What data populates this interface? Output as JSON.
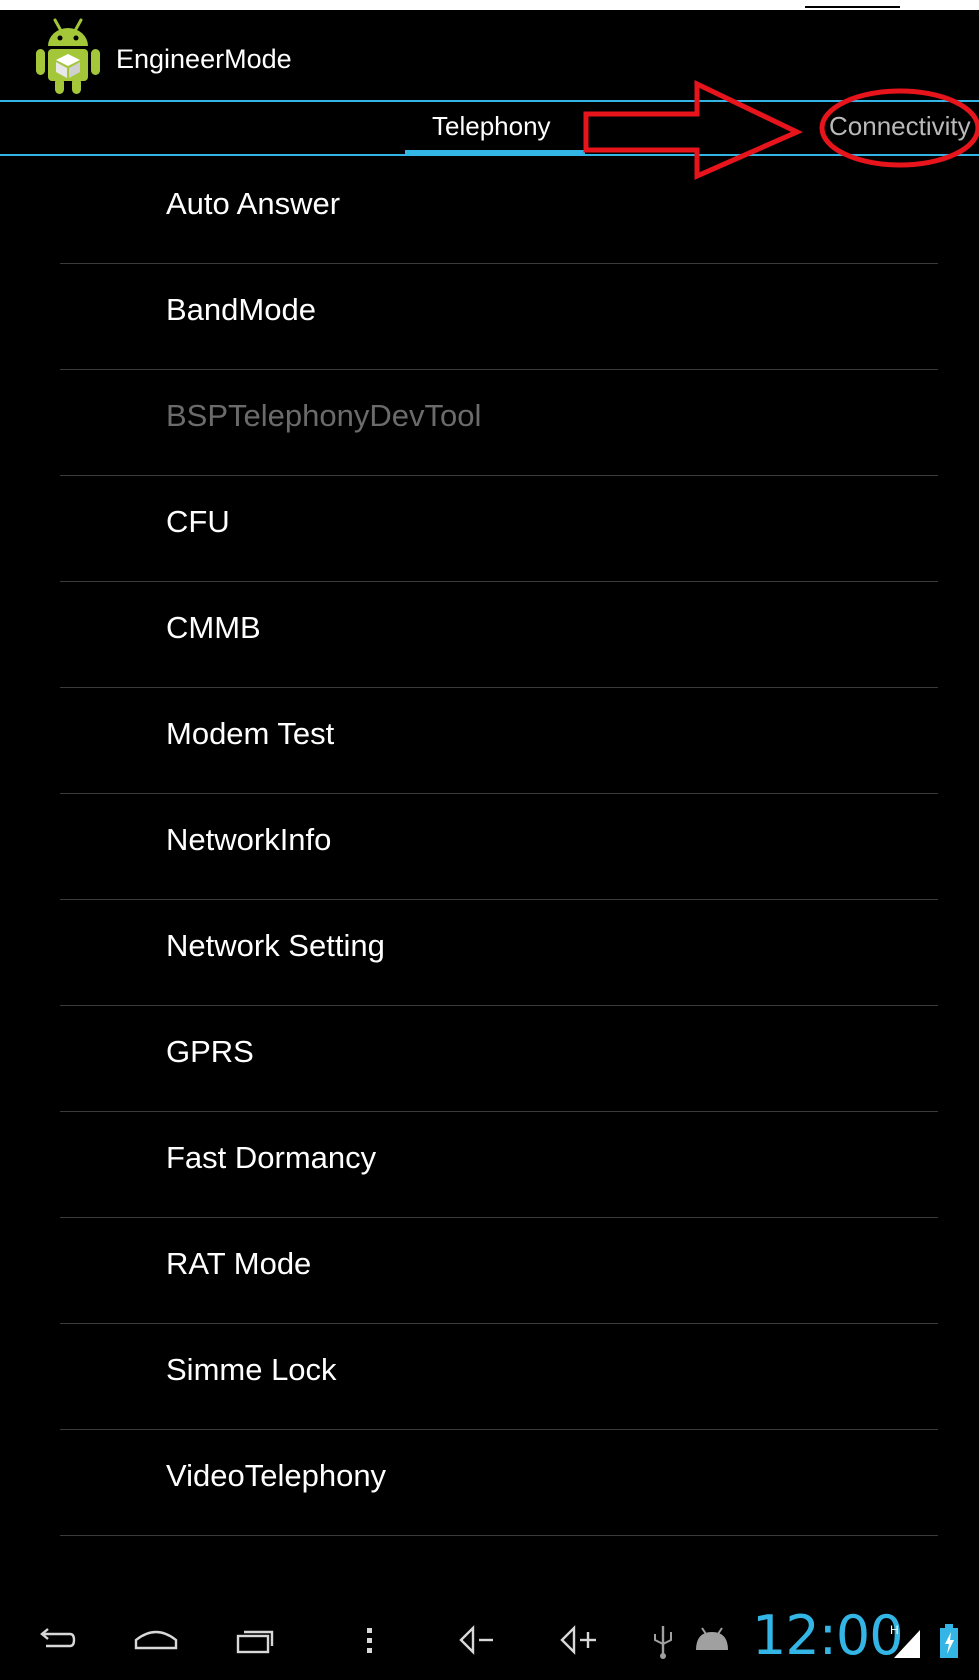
{
  "app": {
    "title": "EngineerMode"
  },
  "tabs": [
    {
      "label": "Telephony",
      "selected": true
    },
    {
      "label": "Connectivity",
      "selected": false
    }
  ],
  "list": {
    "items": [
      {
        "label": "Auto Answer",
        "enabled": true
      },
      {
        "label": "BandMode",
        "enabled": true
      },
      {
        "label": "BSPTelephonyDevTool",
        "enabled": false
      },
      {
        "label": "CFU",
        "enabled": true
      },
      {
        "label": "CMMB",
        "enabled": true
      },
      {
        "label": "Modem Test",
        "enabled": true
      },
      {
        "label": "NetworkInfo",
        "enabled": true
      },
      {
        "label": "Network Setting",
        "enabled": true
      },
      {
        "label": "GPRS",
        "enabled": true
      },
      {
        "label": "Fast Dormancy",
        "enabled": true
      },
      {
        "label": "RAT Mode",
        "enabled": true
      },
      {
        "label": "Simme Lock",
        "enabled": true
      },
      {
        "label": "VideoTelephony",
        "enabled": true
      }
    ]
  },
  "system_bar": {
    "time": "12:00",
    "icons": [
      "back-icon",
      "home-icon",
      "recent-apps-icon",
      "menu-icon",
      "volume-down-icon",
      "volume-up-icon",
      "usb-icon",
      "android-debug-icon",
      "signal-icon",
      "battery-charging-icon"
    ],
    "network_indicator": "H"
  },
  "colors": {
    "accent": "#33b5e5",
    "background": "#000000",
    "annotation": "#e8141c",
    "disabled_text": "#6b6b6b"
  }
}
